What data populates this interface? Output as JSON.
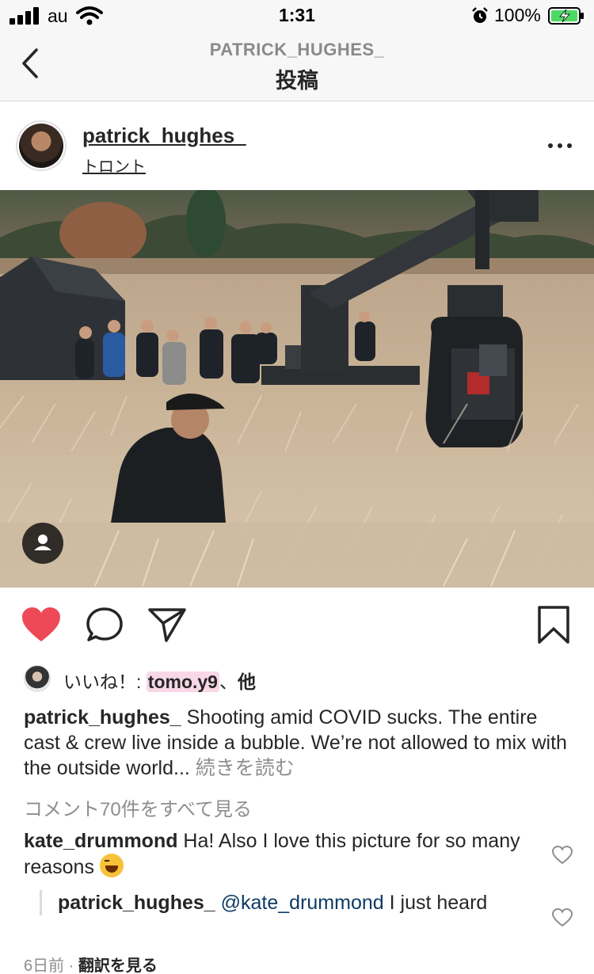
{
  "status_bar": {
    "carrier": "au",
    "time": "1:31",
    "battery_percent": "100%",
    "icons": [
      "signal-icon",
      "wifi-icon",
      "alarm-icon",
      "battery-charging-icon"
    ]
  },
  "nav": {
    "subtitle": "PATRICK_HUGHES_",
    "title": "投稿",
    "back_icon": "chevron-left-icon"
  },
  "post": {
    "username": "patrick_hughes_",
    "location": "トロント",
    "more_icon": "ellipsis-icon",
    "photo_description_icon": "user-tag-icon"
  },
  "actions": {
    "like_icon": "heart-filled-icon",
    "like_color": "#ed4956",
    "comment_icon": "comment-icon",
    "share_icon": "send-icon",
    "save_icon": "bookmark-icon"
  },
  "likes": {
    "prefix": "いいね！: ",
    "user": "tomo.y9",
    "suffix_sep": "、",
    "suffix": "他"
  },
  "caption": {
    "user": "patrick_hughes_",
    "text": " Shooting amid COVID sucks. The entire cast & crew live inside a bubble. We’re not allowed to mix with the outside world... ",
    "more": "続きを読む"
  },
  "view_all_comments": "コメント70件をすべて見る",
  "comments": [
    {
      "user": "kate_drummond",
      "text": " Ha! Also I love this picture for so many reasons ",
      "emoji": "grinning-squinting-face-emoji"
    }
  ],
  "reply": {
    "user": "patrick_hughes_",
    "mention": " @kate_drummond",
    "text": " I just heard"
  },
  "meta": {
    "time": "6日前",
    "separator": " · ",
    "translate": "翻訳を見る"
  }
}
